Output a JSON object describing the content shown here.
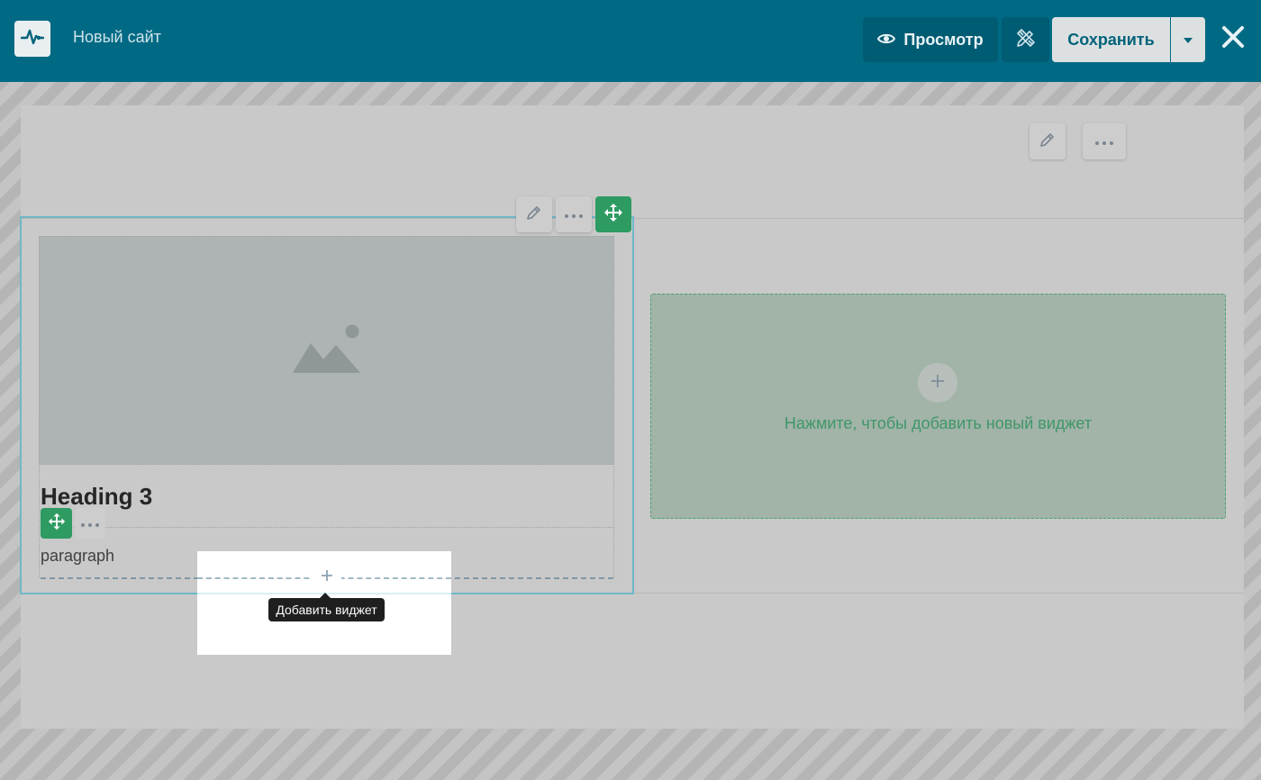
{
  "header": {
    "logo_icon": "pulse-icon",
    "site_title": "Новый сайт",
    "preview_label": "Просмотр",
    "preview_icon": "eye-icon",
    "design_icon": "pencil-ruler-icon",
    "save_label": "Сохранить",
    "save_menu_icon": "caret-down-icon",
    "close_icon": "close-icon",
    "color": "#006a84"
  },
  "section_top": {
    "edit_icon": "pencil-icon",
    "more_icon": "more-dots-icon"
  },
  "column": {
    "edit_icon": "pencil-icon",
    "more_icon": "more-dots-icon",
    "move_icon": "move-icon",
    "image_icon": "image-placeholder-icon",
    "heading": "Heading 3",
    "paragraph": "paragraph",
    "add_widget_tooltip": "Добавить виджет"
  },
  "empty_column": {
    "cta": "Нажмите, чтобы добавить новый виджет",
    "accent": "#3f9769"
  }
}
